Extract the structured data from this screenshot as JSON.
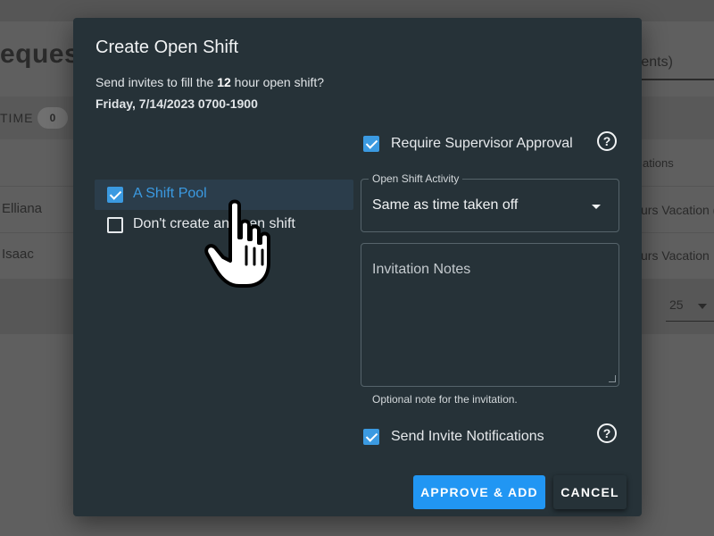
{
  "background": {
    "page_title": "eques",
    "search_text": "ments)",
    "time_tab": {
      "label": "TIME",
      "count": "0"
    },
    "column_header": "ations",
    "rows": [
      {
        "name": "Elliana",
        "type": "urs Vacation ("
      },
      {
        "name": "Isaac",
        "type": "urs Vacation"
      }
    ],
    "per_page": "25"
  },
  "dialog": {
    "title": "Create Open Shift",
    "subtitle_prefix": "Send invites to fill the ",
    "subtitle_hours": "12",
    "subtitle_suffix": " hour open shift?",
    "date_line": "Friday, 7/14/2023 0700-1900",
    "options": [
      {
        "label": "A Shift Pool",
        "checked": true,
        "active": true
      },
      {
        "label": "Don't create an open shift",
        "checked": false,
        "active": false
      }
    ],
    "require_supervisor": {
      "label": "Require Supervisor Approval",
      "checked": true
    },
    "activity": {
      "legend": "Open Shift Activity",
      "value": "Same as time taken off"
    },
    "notes": {
      "placeholder": "Invitation Notes",
      "hint": "Optional note for the invitation."
    },
    "send_notifications": {
      "label": "Send Invite Notifications",
      "checked": true
    },
    "help_glyph": "?",
    "buttons": {
      "approve": "APPROVE & ADD",
      "cancel": "CANCEL"
    }
  },
  "colors": {
    "accent": "#2196f3",
    "dialog_bg": "#263238",
    "active_option_text": "#3b9ae1"
  },
  "icons": {
    "cursor": "hand-pointer-icon",
    "checkbox": "check-icon",
    "help": "help-circle-icon",
    "dropdown": "caret-down-icon"
  }
}
